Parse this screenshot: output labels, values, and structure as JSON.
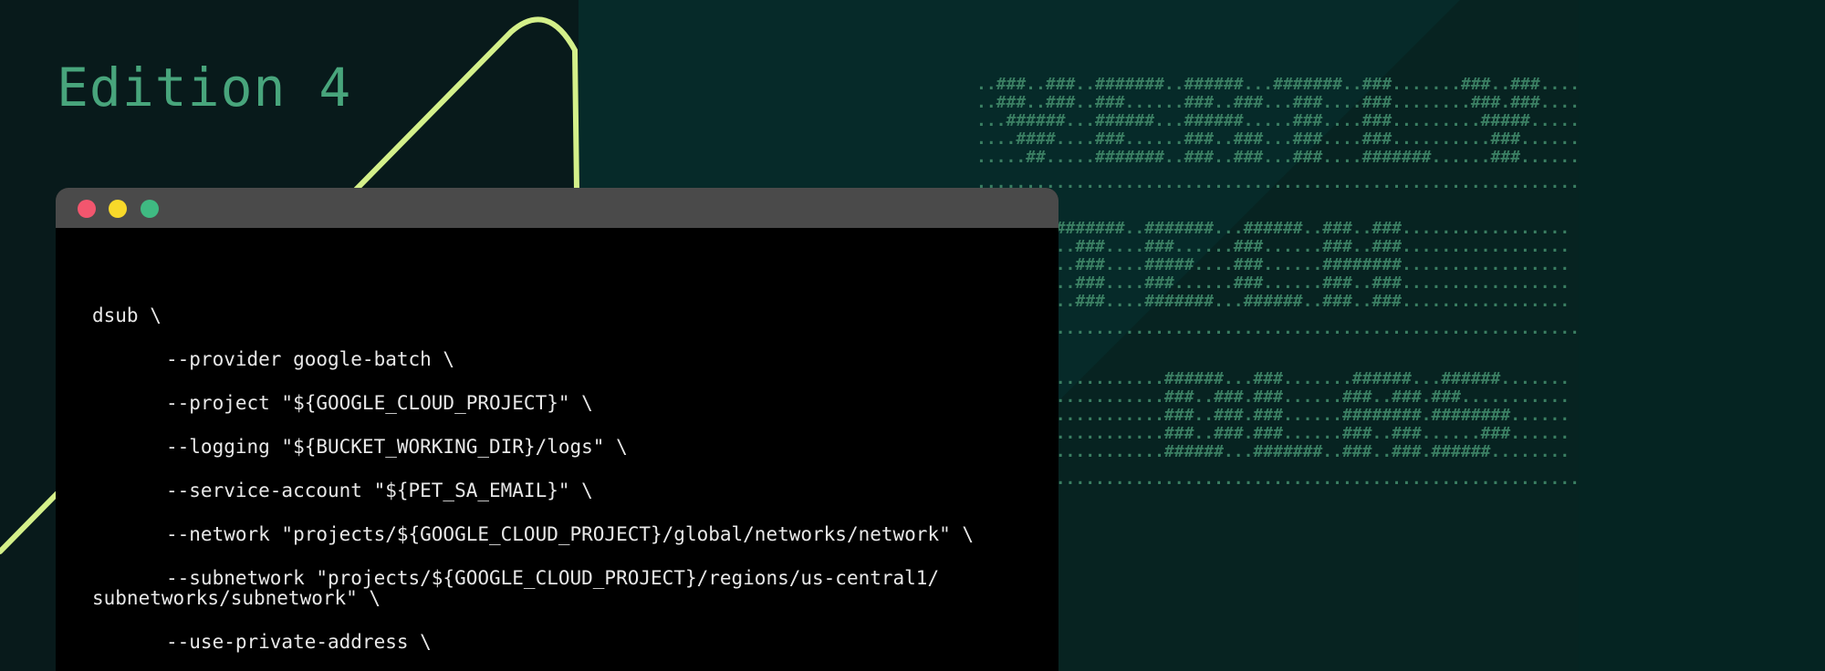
{
  "header": {
    "edition_title": "Edition 4"
  },
  "banner": {
    "ascii_art_lines": [
      "..###..###..#######..######...#######..###.......###..###....",
      "..###..###..###......###..###...###....###........###.###....",
      "...######...######...######.....###....###.........#####.....",
      "....####....###......###..###...###....###..........###......",
      ".....##.....#######..###..###...###....#######......###......",
      ".............................................................",
      "........#######..#######...######..###..###.................",
      "..........###....###......###......###..###.................",
      "..........###....#####....###......########.................",
      "..........###....###......###......###..###.................",
      "..........###....#######...######..###..###.................",
      ".............................................................",
      "...................######...###.......######...######.......",
      "...................###..###.###......###..###.###...........",
      "...................###..###.###......########.########......",
      "...................###..###.###......###..###......###......",
      "...................######...#######..###..###.######........",
      "............................................................."
    ]
  },
  "terminal": {
    "window_buttons": [
      "close",
      "minimize",
      "maximize"
    ],
    "colors": {
      "close": "#f2566e",
      "minimize": "#f8d92a",
      "maximize": "#3fba82"
    },
    "code_lines": [
      "dsub \\",
      "--provider google-batch \\",
      "--project \"${GOOGLE_CLOUD_PROJECT}\" \\",
      "--logging \"${BUCKET_WORKING_DIR}/logs\" \\",
      "--service-account \"${PET_SA_EMAIL}\" \\",
      "--network \"projects/${GOOGLE_CLOUD_PROJECT}/global/networks/network\" \\",
      "--subnetwork \"projects/${GOOGLE_CLOUD_PROJECT}/regions/us-central1/",
      "subnetworks/subnetwork\" \\",
      "--use-private-address \\"
    ]
  },
  "colors": {
    "background": "#081a1b",
    "panel": "#062a29",
    "accent_line": "#d4f08a",
    "title": "#48a57c"
  }
}
